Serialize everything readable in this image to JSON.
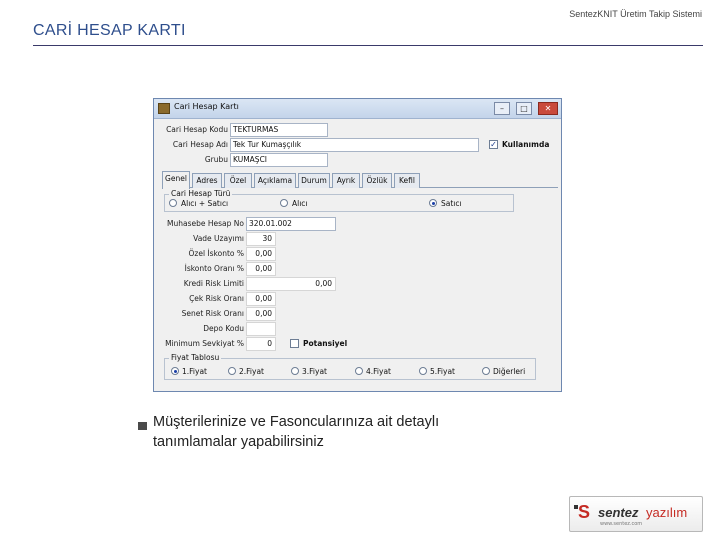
{
  "slide": {
    "title": "CARİ HESAP KARTI",
    "header_right": "SentezKNIT Üretim Takip Sistemi",
    "bullet_text": "Müşterilerinize ve Fasoncularınıza ait detaylı tanımlamalar yapabilirsiniz"
  },
  "window": {
    "title": "Cari Hesap Kartı",
    "controls": {
      "minimize": "–",
      "maximize": "□",
      "close": "✕"
    }
  },
  "header_fields": {
    "kodu_label": "Cari Hesap Kodu",
    "kodu_value": "TEKTURMAS",
    "adi_label": "Cari Hesap Adı",
    "adi_value": "Tek Tur Kumaşçılık",
    "grubu_label": "Grubu",
    "grubu_value": "KUMAŞCI",
    "kullanimda_label": "Kullanımda",
    "kullanimda_checked": true
  },
  "tabs": [
    "Genel",
    "Adres",
    "Özel",
    "Açıklama",
    "Durum",
    "Ayrık",
    "Özlük",
    "Kefil"
  ],
  "active_tab": "Genel",
  "hesap_turu": {
    "legend": "Cari Hesap Türü",
    "options": [
      {
        "label": "Alıcı + Satıcı",
        "selected": false
      },
      {
        "label": "Alıcı",
        "selected": false
      },
      {
        "label": "Satıcı",
        "selected": true
      }
    ]
  },
  "genel": {
    "muhasebe_label": "Muhasebe Hesap No",
    "muhasebe_value": "320.01.002",
    "vade_label": "Vade Uzayımı",
    "vade_value": "30",
    "ozel_iskonto_label": "Özel İskonto %",
    "ozel_iskonto_value": "0,00",
    "iskonto_label": "İskonto Oranı %",
    "iskonto_value": "0,00",
    "kredi_label": "Kredi Risk Limiti",
    "kredi_value": "0,00",
    "cek_label": "Çek Risk Oranı",
    "cek_value": "0,00",
    "senet_label": "Senet Risk Oranı",
    "senet_value": "0,00",
    "depo_label": "Depo Kodu",
    "depo_value": "",
    "minimum_label": "Minimum Sevkiyat %",
    "minimum_value": "0",
    "potansiyel_label": "Potansiyel",
    "potansiyel_checked": false
  },
  "fiyat": {
    "legend": "Fiyat Tablosu",
    "options": [
      {
        "label": "1.Fiyat",
        "selected": true
      },
      {
        "label": "2.Fiyat",
        "selected": false
      },
      {
        "label": "3.Fiyat",
        "selected": false
      },
      {
        "label": "4.Fiyat",
        "selected": false
      },
      {
        "label": "5.Fiyat",
        "selected": false
      },
      {
        "label": "Diğerleri",
        "selected": false
      }
    ]
  },
  "logo": {
    "mark": "S",
    "sentez": "sentez",
    "yazilim": "yazılım",
    "url": "www.sentez.com"
  }
}
